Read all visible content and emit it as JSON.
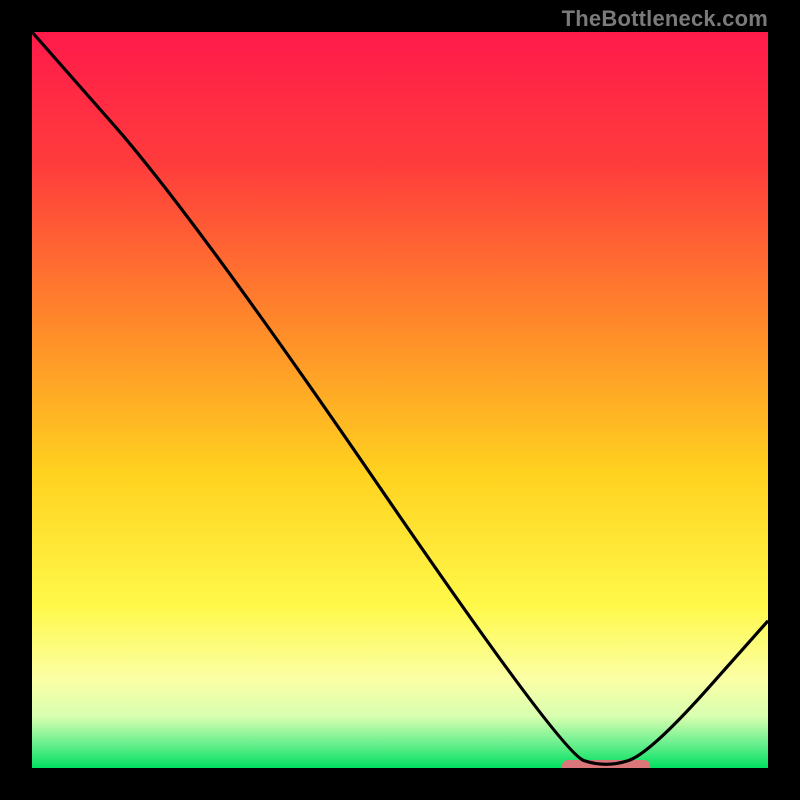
{
  "watermark": "TheBottleneck.com",
  "chart_data": {
    "type": "line",
    "title": "",
    "xlabel": "",
    "ylabel": "",
    "xlim": [
      0,
      100
    ],
    "ylim": [
      0,
      100
    ],
    "x": [
      0,
      22,
      72,
      78,
      84,
      100
    ],
    "values": [
      100,
      75,
      2,
      0,
      2,
      20
    ],
    "marker": {
      "x_start": 72,
      "x_end": 84,
      "y": 0
    },
    "gradient_stops": [
      {
        "pos": 0.0,
        "color": "#ff1a4b"
      },
      {
        "pos": 0.18,
        "color": "#ff3c3c"
      },
      {
        "pos": 0.4,
        "color": "#ff8a2a"
      },
      {
        "pos": 0.6,
        "color": "#ffd21f"
      },
      {
        "pos": 0.78,
        "color": "#fff94a"
      },
      {
        "pos": 0.88,
        "color": "#fbffa6"
      },
      {
        "pos": 0.93,
        "color": "#d8ffb0"
      },
      {
        "pos": 0.965,
        "color": "#70f090"
      },
      {
        "pos": 1.0,
        "color": "#00e060"
      }
    ],
    "marker_color": "#d9777a",
    "line_color": "#000000"
  }
}
